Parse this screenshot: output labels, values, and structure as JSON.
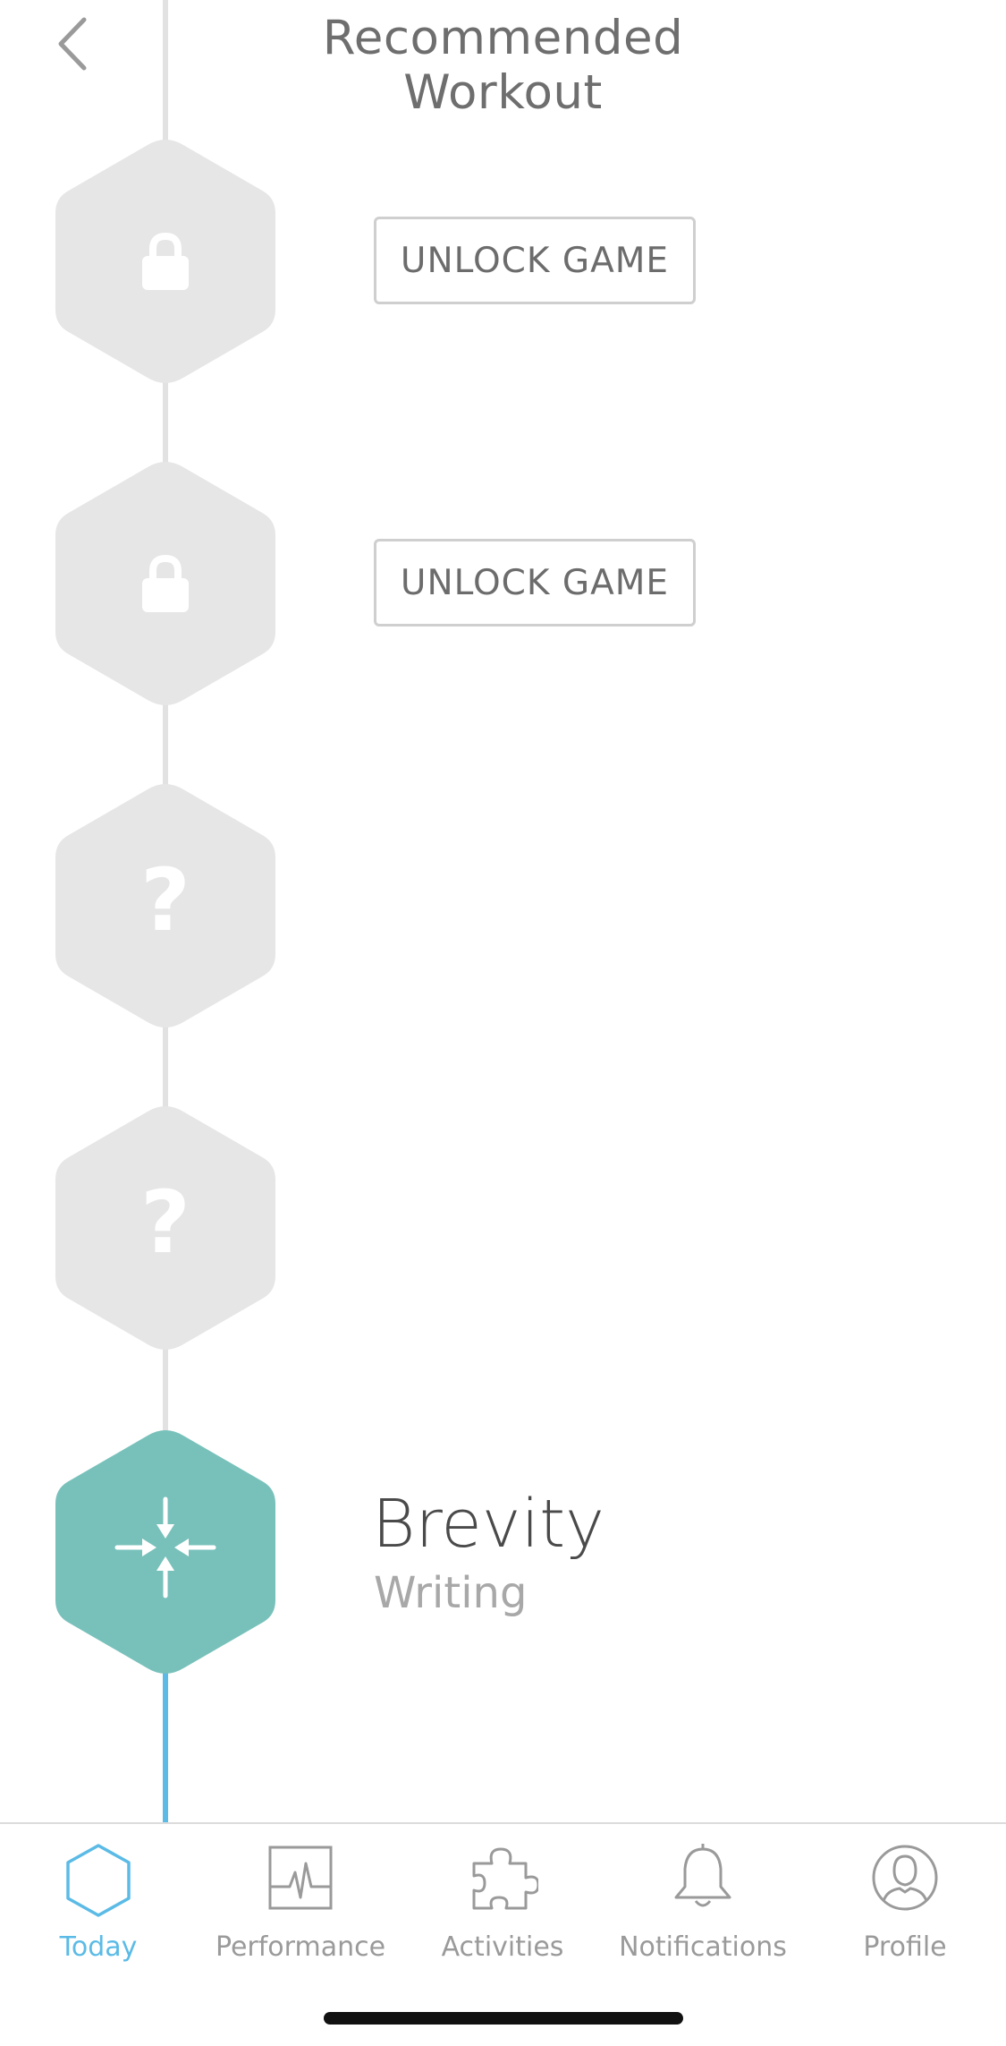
{
  "header": {
    "title": "Recommended Workout",
    "back_icon": "chevron-left-icon"
  },
  "workout": {
    "items": [
      {
        "state": "locked",
        "icon": "lock-icon",
        "action_label": "UNLOCK GAME"
      },
      {
        "state": "locked",
        "icon": "lock-icon",
        "action_label": "UNLOCK GAME"
      },
      {
        "state": "unknown",
        "icon": "question-icon",
        "glyph": "?"
      },
      {
        "state": "unknown",
        "icon": "question-icon",
        "glyph": "?"
      },
      {
        "state": "active",
        "icon": "compress-arrows-icon",
        "name": "Brevity",
        "category": "Writing"
      }
    ],
    "locked_color": "#e6e6e6",
    "active_color": "#78c1bb",
    "progress_color": "#5bbbe6"
  },
  "tabbar": {
    "tabs": [
      {
        "label": "Today",
        "icon": "hexagon-icon",
        "active": true
      },
      {
        "label": "Performance",
        "icon": "pulse-chart-icon",
        "active": false
      },
      {
        "label": "Activities",
        "icon": "puzzle-piece-icon",
        "active": false
      },
      {
        "label": "Notifications",
        "icon": "bell-icon",
        "active": false
      },
      {
        "label": "Profile",
        "icon": "user-icon",
        "active": false
      }
    ],
    "active_color": "#5bbbe6",
    "inactive_color": "#9a9a9a"
  }
}
